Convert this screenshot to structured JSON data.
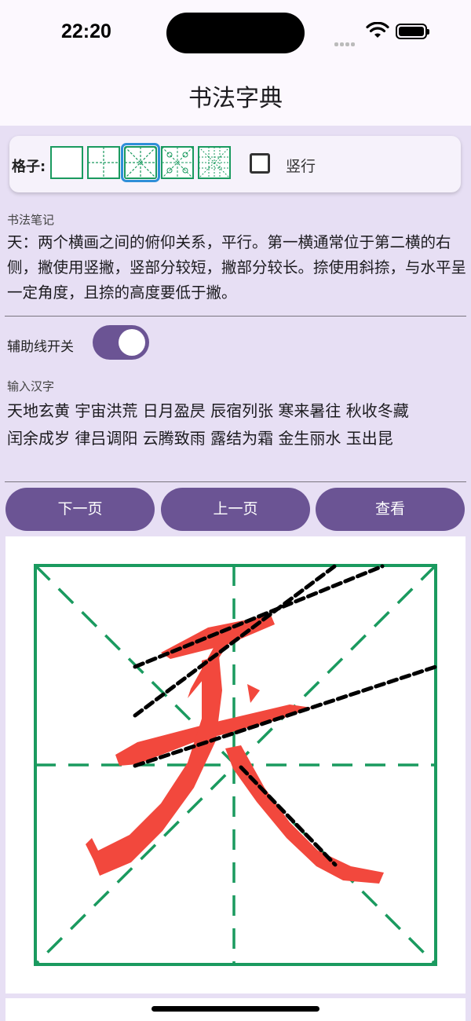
{
  "status": {
    "time": "22:20"
  },
  "app": {
    "title": "书法字典"
  },
  "grid": {
    "label": "格子:",
    "options": [
      "blank",
      "cross",
      "rice",
      "rice-nine",
      "nine-palace"
    ],
    "selected": "rice",
    "vertical_label": "竖行",
    "vertical_checked": false,
    "colors": {
      "grid_line": "#1a9a5f",
      "selection": "#2f8fd8"
    }
  },
  "notes": {
    "label": "书法笔记",
    "text": "天：两个横画之间的俯仰关系，平行。第一横通常位于第二横的右侧，撇使用竖撇，竖部分较短，撇部分较长。捺使用斜捺，与水平呈一定角度，且捺的高度要低于撇。"
  },
  "aux": {
    "label": "辅助线开关",
    "enabled": true
  },
  "input": {
    "label": "输入汉字",
    "text": "天地玄黄 宇宙洪荒 日月盈昃 辰宿列张 寒来暑往 秋收冬藏\n闰余成岁 律吕调阳 云腾致雨 露结为霜 金生丽水 玉出昆"
  },
  "buttons": {
    "next": "下一页",
    "prev": "上一页",
    "view": "查看"
  },
  "display": {
    "character_color": "#f2483d",
    "guide_color": "#000000",
    "grid_color": "#1a9a5f"
  },
  "colors": {
    "accent": "#6b5494",
    "background": "#e7dff4"
  }
}
